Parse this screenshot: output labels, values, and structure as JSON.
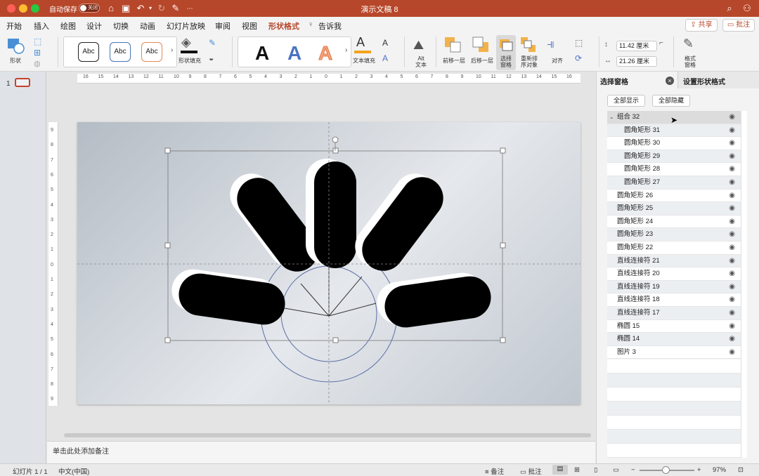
{
  "window": {
    "title": "演示文稿 8",
    "autosave_label": "自动保存",
    "autosave_state": "关闭"
  },
  "tabs": [
    "开始",
    "插入",
    "绘图",
    "设计",
    "切换",
    "动画",
    "幻灯片放映",
    "审阅",
    "视图",
    "形状格式",
    "告诉我"
  ],
  "header_buttons": {
    "share": "共享",
    "comment": "批注"
  },
  "ribbon": {
    "shapes_label": "形状",
    "shape_styles": [
      "Abc",
      "Abc",
      "Abc"
    ],
    "shape_fill_label": "形状填充",
    "wordart": [
      "A",
      "A",
      "A"
    ],
    "text_fill_label": "文本填充",
    "alt_text_label": "Alt\n文本",
    "bring_forward": "前移一层",
    "send_backward": "后移一层",
    "selection_pane": "选择\n窗格",
    "reorder": "重新排\n序对象",
    "align": "对齐",
    "height": "11.42 厘米",
    "width": "21.26 厘米",
    "format_pane": "格式\n窗格"
  },
  "thumbnails": {
    "slide_number": "1"
  },
  "notes_placeholder": "单击此处添加备注",
  "selection_pane": {
    "title": "选择窗格",
    "other_tab": "设置形状格式",
    "show_all": "全部显示",
    "hide_all": "全部隐藏",
    "items": [
      {
        "label": "组合 32",
        "level": 0,
        "expanded": true,
        "selected": true
      },
      {
        "label": "圆角矩形 31",
        "level": 1
      },
      {
        "label": "圆角矩形 30",
        "level": 1
      },
      {
        "label": "圆角矩形 29",
        "level": 1
      },
      {
        "label": "圆角矩形 28",
        "level": 1
      },
      {
        "label": "圆角矩形 27",
        "level": 1
      },
      {
        "label": "圆角矩形 26",
        "level": 0
      },
      {
        "label": "圆角矩形 25",
        "level": 0
      },
      {
        "label": "圆角矩形 24",
        "level": 0
      },
      {
        "label": "圆角矩形 23",
        "level": 0
      },
      {
        "label": "圆角矩形 22",
        "level": 0
      },
      {
        "label": "直线连接符 21",
        "level": 0
      },
      {
        "label": "直线连接符 20",
        "level": 0
      },
      {
        "label": "直线连接符 19",
        "level": 0
      },
      {
        "label": "直线连接符 18",
        "level": 0
      },
      {
        "label": "直线连接符 17",
        "level": 0
      },
      {
        "label": "椭圆 15",
        "level": 0
      },
      {
        "label": "椭圆 14",
        "level": 0
      },
      {
        "label": "图片 3",
        "level": 0
      }
    ]
  },
  "status": {
    "slide_info": "幻灯片 1 / 1",
    "language": "中文(中国)",
    "notes": "备注",
    "comments": "批注",
    "zoom": "97%"
  },
  "colors": {
    "accent": "#b7472a"
  }
}
